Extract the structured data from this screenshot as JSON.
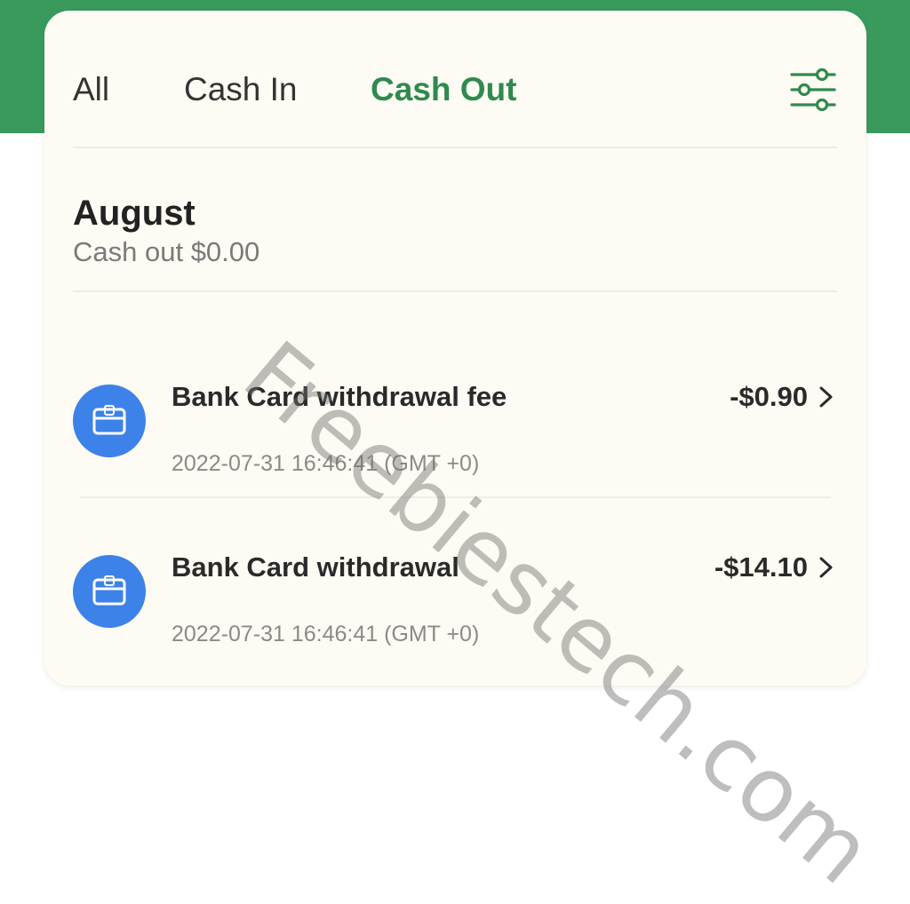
{
  "colors": {
    "brand_green": "#3a9a5e",
    "active_tab": "#2f8a4f",
    "card_bg": "#fdfbf3",
    "icon_blue": "#3c82e8"
  },
  "tabs": [
    {
      "label": "All",
      "active": false
    },
    {
      "label": "Cash In",
      "active": false
    },
    {
      "label": "Cash Out",
      "active": true
    }
  ],
  "filter": {
    "icon": "filter-sliders-icon"
  },
  "month": {
    "title": "August",
    "summary": "Cash out $0.00"
  },
  "transactions": [
    {
      "icon": "bank-card-icon",
      "title": "Bank Card withdrawal fee",
      "amount": "-$0.90",
      "time": "2022-07-31 16:46:41 (GMT +0)"
    },
    {
      "icon": "bank-card-icon",
      "title": "Bank Card withdrawal",
      "amount": "-$14.10",
      "time": "2022-07-31 16:46:41 (GMT +0)"
    }
  ],
  "watermark": "Freebiestech.com"
}
